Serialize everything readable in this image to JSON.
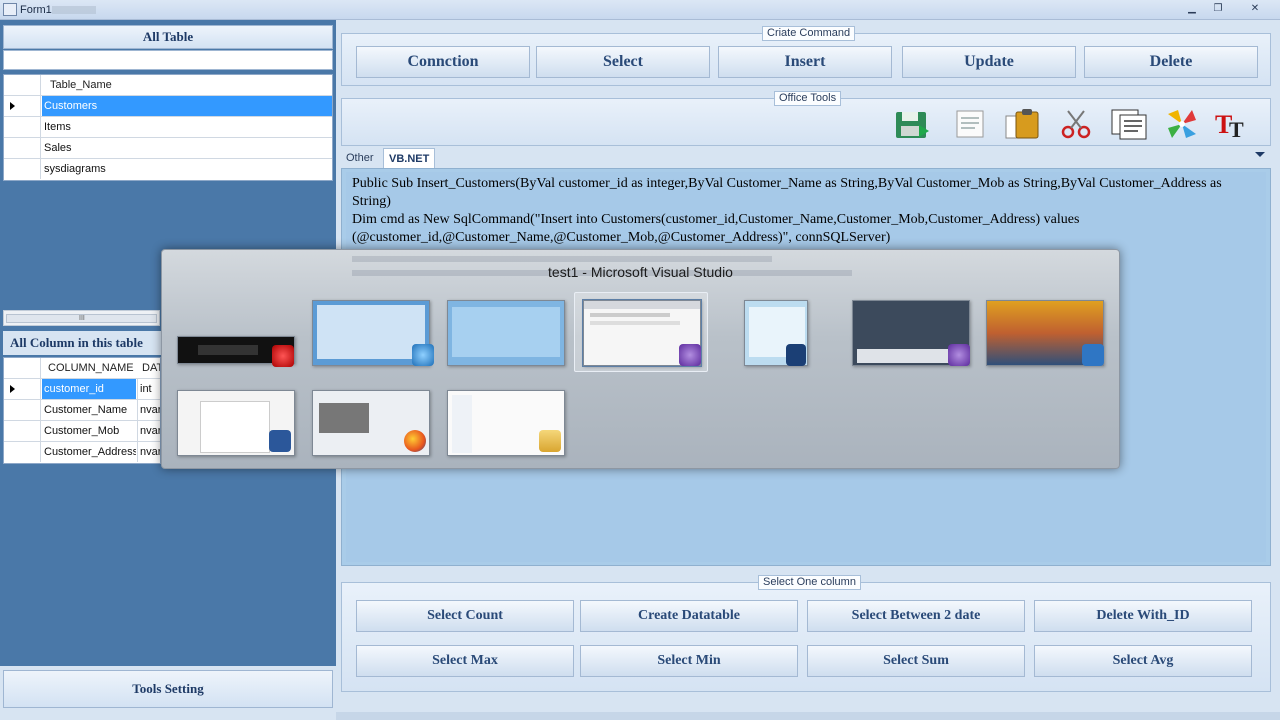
{
  "window": {
    "title": "Form1"
  },
  "left": {
    "all_table_label": "All Table",
    "table_grid": {
      "header": "Table_Name",
      "rows": [
        "Customers",
        "Items",
        "Sales",
        "sysdiagrams"
      ]
    },
    "scroll_grip": "III",
    "column_label": "All Column in this table",
    "column_grid": {
      "headers": [
        "COLUMN_NAME",
        "DAT"
      ],
      "rows": [
        [
          "customer_id",
          "int"
        ],
        [
          "Customer_Name",
          "nvarc"
        ],
        [
          "Customer_Mob",
          "nvarc"
        ],
        [
          "Customer_Address",
          "nvarc"
        ]
      ]
    },
    "tools_setting_label": "Tools Setting"
  },
  "create_command": {
    "label": "Criate Command",
    "buttons": [
      "Connction",
      "Select",
      "Insert",
      "Update",
      "Delete"
    ]
  },
  "office_tools": {
    "label": "Office Tools",
    "icons": [
      "save-icon",
      "document-icon",
      "clipboard-icon",
      "scissors-icon",
      "notepad-icon",
      "pinwheel-icon",
      "text-style-icon"
    ]
  },
  "tabs": {
    "items": [
      "Other",
      "VB.NET"
    ],
    "active": "VB.NET"
  },
  "code_lines": [
    "Public Sub Insert_Customers(ByVal customer_id as integer,ByVal Customer_Name as String,ByVal Customer_Mob as String,ByVal Customer_Address as String)",
    "Dim cmd as New SqlCommand(\"Insert into Customers(customer_id,Customer_Name,Customer_Mob,Customer_Address) values (@customer_id,@Customer_Name,@Customer_Mob,@Customer_Address)\", connSQLServer)"
  ],
  "task_switcher": {
    "caption": "test1 - Microsoft Visual Studio"
  },
  "select_one_column": {
    "label": "Select One column",
    "row1": [
      "Select Count",
      "Create Datatable",
      "Select Between 2 date",
      "Delete With_ID"
    ],
    "row2": [
      "Select Max",
      "Select Min",
      "Select Sum",
      "Select Avg"
    ]
  },
  "colors": {
    "accent": "#3399ff",
    "panel": "#4a78a8",
    "code_bg": "#a6c9e8"
  }
}
